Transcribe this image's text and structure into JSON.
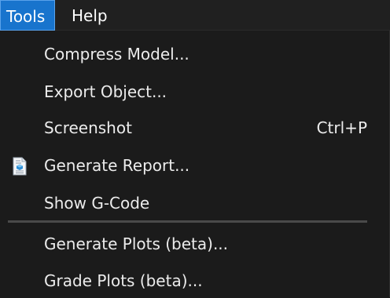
{
  "menubar": {
    "tools_label": "Tools",
    "help_label": "Help"
  },
  "menu": {
    "items": [
      {
        "label": "Compress Model...",
        "shortcut": ""
      },
      {
        "label": "Export Object...",
        "shortcut": ""
      },
      {
        "label": "Screenshot",
        "shortcut": "Ctrl+P"
      },
      {
        "label": "Generate Report...",
        "shortcut": "",
        "icon": "report-document-icon"
      },
      {
        "label": "Show G-Code",
        "shortcut": ""
      },
      {
        "label": "Generate Plots (beta)...",
        "shortcut": ""
      },
      {
        "label": "Grade Plots (beta)...",
        "shortcut": ""
      }
    ]
  },
  "colors": {
    "background": "#1b1b1b",
    "menubar_background": "#202020",
    "active_menu_highlight": "#1874cd",
    "text": "#ececec",
    "separator": "#4a4a4a"
  }
}
